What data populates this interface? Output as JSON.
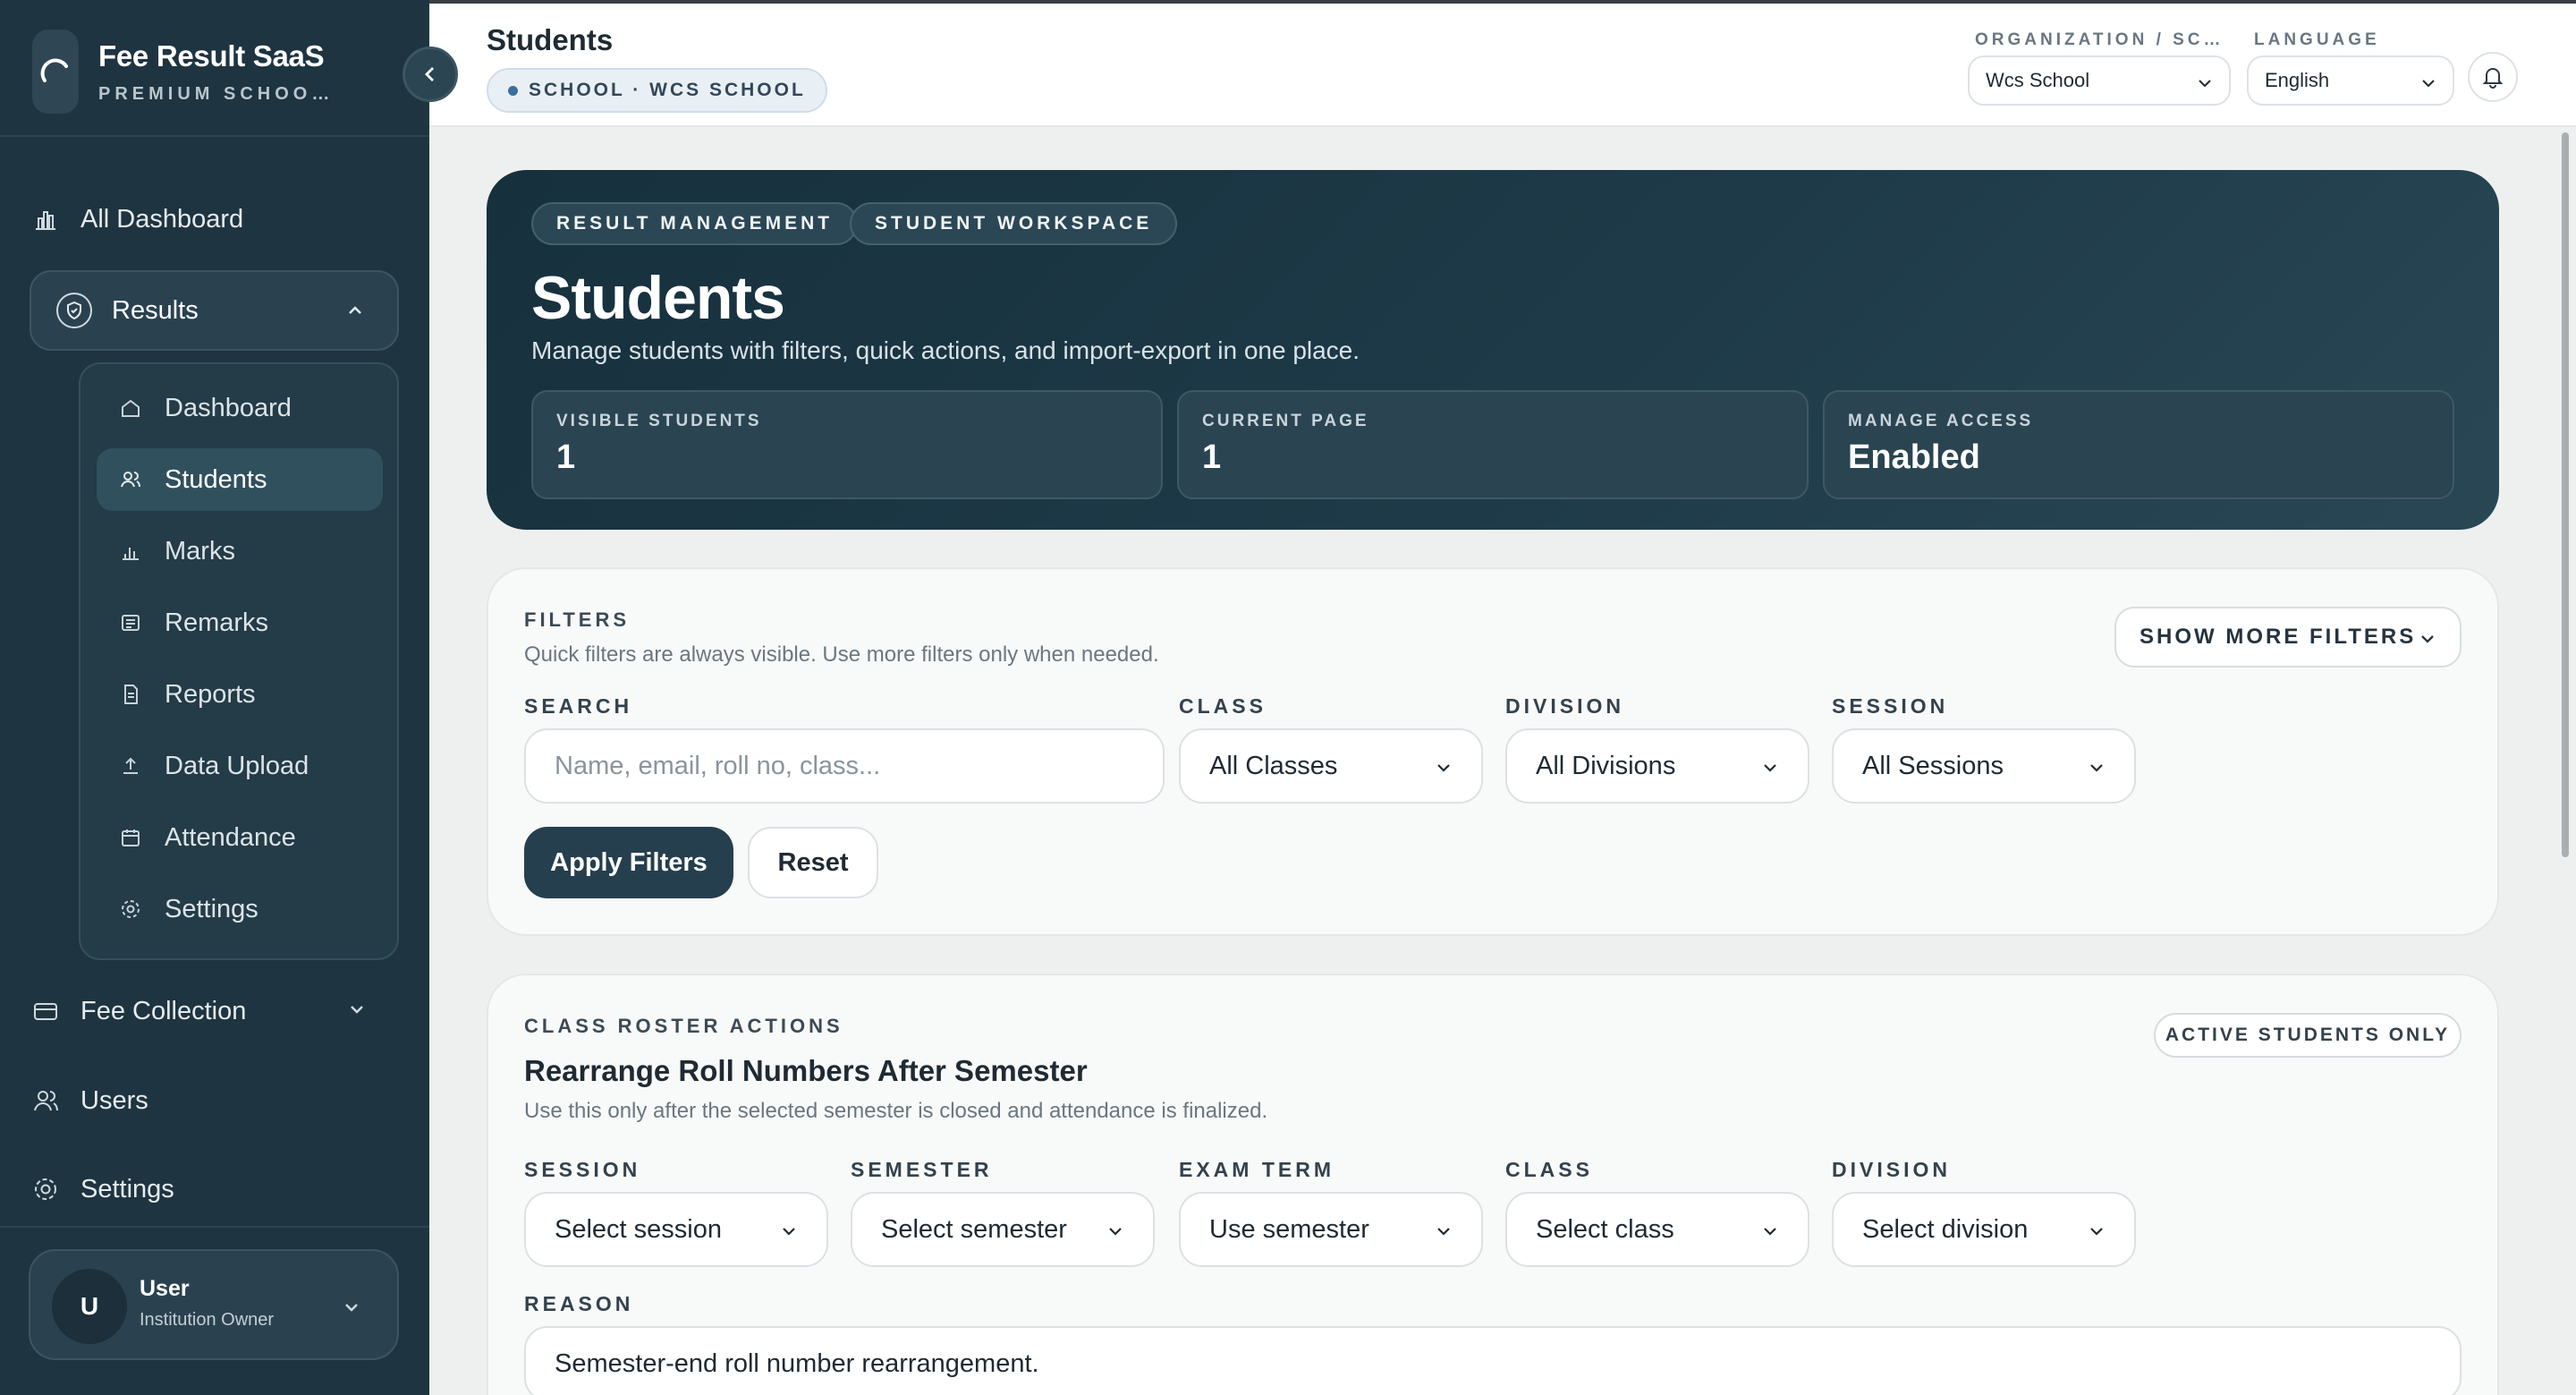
{
  "brand": {
    "title": "Fee Result SaaS",
    "subtitle": "PREMIUM SCHOO…"
  },
  "sidebar": {
    "all_dashboard": "All Dashboard",
    "results": "Results",
    "results_items": [
      {
        "label": "Dashboard",
        "icon": "home-icon"
      },
      {
        "label": "Students",
        "icon": "users-icon",
        "active": true
      },
      {
        "label": "Marks",
        "icon": "bar-chart-icon"
      },
      {
        "label": "Remarks",
        "icon": "note-icon"
      },
      {
        "label": "Reports",
        "icon": "report-icon"
      },
      {
        "label": "Data Upload",
        "icon": "upload-icon"
      },
      {
        "label": "Attendance",
        "icon": "calendar-icon"
      },
      {
        "label": "Settings",
        "icon": "gear-icon"
      }
    ],
    "fee_collection": "Fee Collection",
    "users": "Users",
    "settings": "Settings",
    "user": {
      "initial": "U",
      "name": "User",
      "role": "Institution Owner"
    }
  },
  "topbar": {
    "title": "Students",
    "school_chip": "SCHOOL · WCS SCHOOL",
    "org_label": "ORGANIZATION / SC…",
    "org_value": "Wcs School",
    "lang_label": "LANGUAGE",
    "lang_value": "English"
  },
  "hero": {
    "tag1": "RESULT MANAGEMENT",
    "tag2": "STUDENT WORKSPACE",
    "title": "Students",
    "description": "Manage students with filters, quick actions, and import-export in one place.",
    "stats": [
      {
        "label": "VISIBLE STUDENTS",
        "value": "1"
      },
      {
        "label": "CURRENT PAGE",
        "value": "1"
      },
      {
        "label": "MANAGE ACCESS",
        "value": "Enabled"
      }
    ]
  },
  "filters": {
    "eyebrow": "FILTERS",
    "hint": "Quick filters are always visible. Use more filters only when needed.",
    "show_more": "SHOW MORE FILTERS",
    "search_label": "SEARCH",
    "search_placeholder": "Name, email, roll no, class...",
    "class_label": "CLASS",
    "class_value": "All Classes",
    "division_label": "DIVISION",
    "division_value": "All Divisions",
    "session_label": "SESSION",
    "session_value": "All Sessions",
    "apply": "Apply Filters",
    "reset": "Reset"
  },
  "roster": {
    "eyebrow": "CLASS ROSTER ACTIONS",
    "badge": "ACTIVE STUDENTS ONLY",
    "title": "Rearrange Roll Numbers After Semester",
    "hint": "Use this only after the selected semester is closed and attendance is finalized.",
    "session_label": "SESSION",
    "session_value": "Select session",
    "semester_label": "SEMESTER",
    "semester_value": "Select semester",
    "exam_label": "EXAM TERM",
    "exam_value": "Use semester",
    "class_label": "CLASS",
    "class_value": "Select class",
    "division_label": "DIVISION",
    "division_value": "Select division",
    "reason_label": "REASON",
    "reason_value": "Semester-end roll number rearrangement."
  },
  "colors": {
    "sidebar_bg": "#1f3441",
    "hero_bg": "#1e3a48",
    "primary_button": "#263f4e",
    "page_bg": "#eef0f0"
  }
}
